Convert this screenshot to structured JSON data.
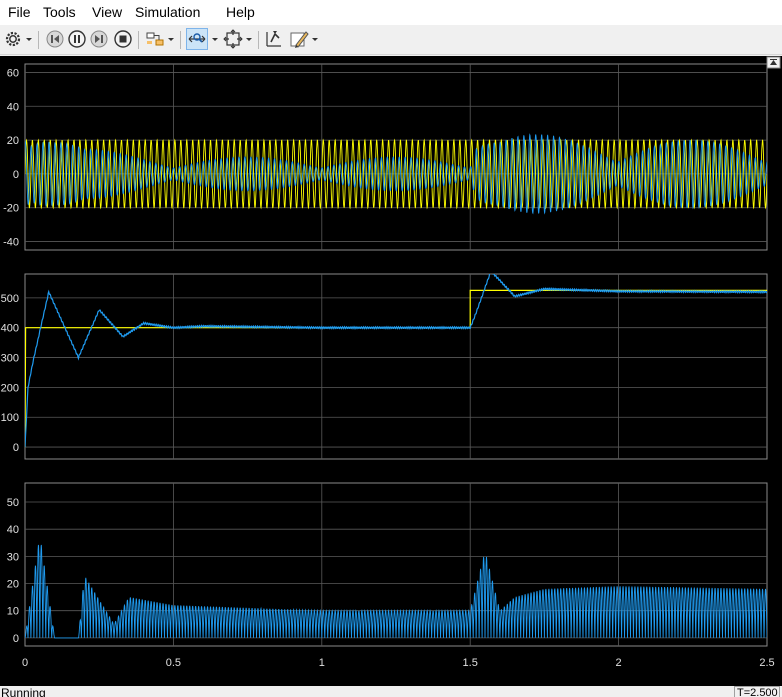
{
  "menu": [
    "File",
    "Tools",
    "View",
    "Simulation",
    "Help"
  ],
  "toolbar": {
    "icons": [
      "settings-gear-icon",
      "dropdown-arrow-icon",
      "step-back-icon",
      "pause-icon",
      "step-forward-icon",
      "stop-icon",
      "highlight-model-icon",
      "dropdown-arrow-icon",
      "zoom-x-icon",
      "dropdown-arrow-icon",
      "fit-to-view-icon",
      "dropdown-arrow-icon",
      "cursor-measure-icon",
      "style-edit-icon",
      "dropdown-arrow-icon"
    ]
  },
  "status": {
    "left": "Running",
    "right": "T=2.500"
  },
  "colors": {
    "background": "#000000",
    "axes": "#2b2b2b",
    "grid": "#5a5a5a",
    "tick_text": "#e0e0e0",
    "signal_1": "#ffff00",
    "signal_2": "#1f9bf0"
  },
  "chart_data": [
    {
      "type": "line",
      "title": "",
      "xlim": [
        0,
        2.5
      ],
      "ylim": [
        -45,
        65
      ],
      "yticks": [
        "60",
        "40",
        "20",
        "0",
        "-20",
        "-40"
      ],
      "grid": true,
      "series": [
        {
          "color": "#ffff00",
          "description_points": {
            "x": [
              0,
              0.5,
              1.0,
              1.5,
              2.0,
              2.5
            ],
            "amplitude": [
              20,
              20,
              20,
              20,
              20,
              20
            ]
          }
        },
        {
          "color": "#1f9bf0",
          "description_points": {
            "x": [
              0,
              0.02,
              0.1,
              0.2,
              0.5,
              1.0,
              1.5,
              1.52,
              1.6,
              2.0,
              2.5
            ],
            "amplitude": [
              55,
              38,
              25,
              15,
              10,
              10,
              10,
              33,
              25,
              20,
              20
            ]
          }
        }
      ]
    },
    {
      "type": "line",
      "title": "",
      "xlim": [
        0,
        2.5
      ],
      "ylim": [
        -40,
        580
      ],
      "yticks": [
        "500",
        "400",
        "300",
        "200",
        "100",
        "0"
      ],
      "grid": true,
      "series": [
        {
          "color": "#ffff00",
          "x": [
            0,
            0.002,
            1.5,
            1.5,
            2.5
          ],
          "y": [
            0,
            400,
            400,
            525,
            525
          ]
        },
        {
          "color": "#1f9bf0",
          "x": [
            0,
            0.01,
            0.03,
            0.08,
            0.18,
            0.25,
            0.33,
            0.4,
            0.5,
            0.6,
            1.0,
            1.5,
            1.52,
            1.57,
            1.65,
            1.75,
            2.0,
            2.5
          ],
          "y": [
            0,
            200,
            300,
            520,
            300,
            460,
            370,
            415,
            400,
            405,
            400,
            400,
            450,
            590,
            505,
            530,
            522,
            520
          ]
        }
      ]
    },
    {
      "type": "line",
      "title": "",
      "xlim": [
        0,
        2.5
      ],
      "xticks": [
        "0",
        "0.5",
        "1",
        "1.5",
        "2",
        "2.5"
      ],
      "ylim": [
        -3,
        57
      ],
      "yticks": [
        "50",
        "40",
        "30",
        "20",
        "10",
        "0"
      ],
      "grid": true,
      "series": [
        {
          "color": "#1f9bf0",
          "x": [
            0,
            0.05,
            0.1,
            0.18,
            0.2,
            0.3,
            0.35,
            0.5,
            1.0,
            1.5,
            1.55,
            1.6,
            1.65,
            1.75,
            2.0,
            2.5
          ],
          "y": [
            0,
            38,
            0,
            0,
            23,
            5,
            15,
            12,
            10,
            10,
            32,
            10,
            15,
            18,
            19,
            18
          ]
        }
      ]
    }
  ]
}
